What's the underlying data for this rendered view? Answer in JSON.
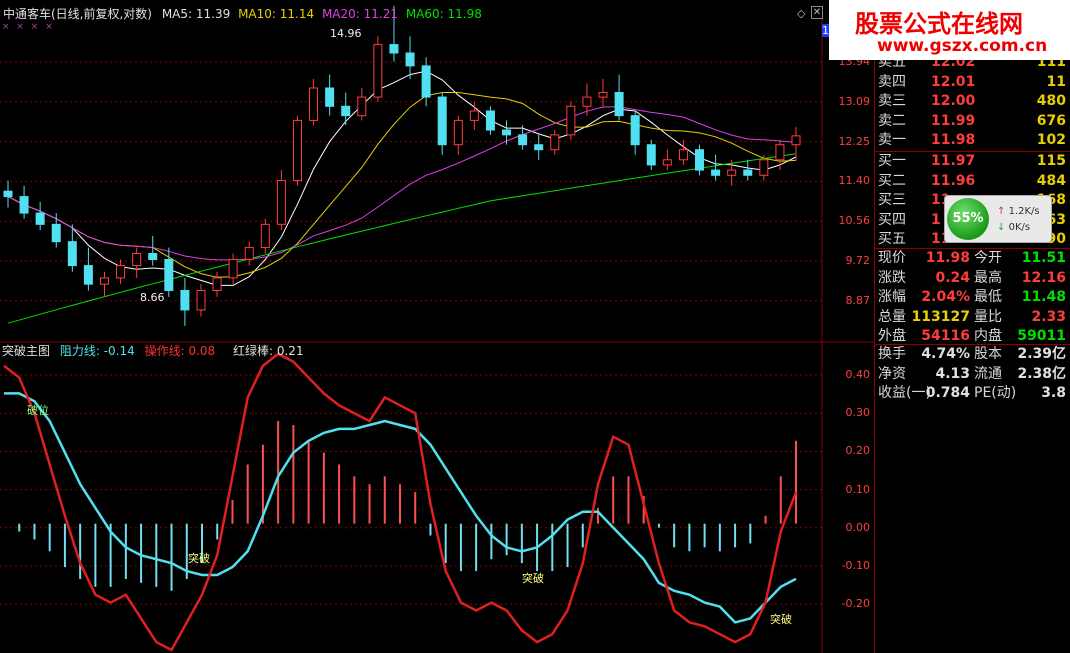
{
  "header": {
    "stock_title": "中通客车(日线,前复权,对数)",
    "ma5": "MA5: 11.39",
    "ma10": "MA10: 11.14",
    "ma20": "MA20: 11.21",
    "ma60": "MA60: 11.98",
    "max_label": "14.96",
    "min_label": "8.66",
    "price_tag": "14.0"
  },
  "price_axis": [
    "13.94",
    "13.09",
    "12.25",
    "11.40",
    "10.56",
    "9.72",
    "8.87"
  ],
  "indicator": {
    "name": "突破主图",
    "resist_label": "阻力线: -0.14",
    "op_label": "操作线: 0.08",
    "redgreen_label": "红绿棒: 0.21",
    "axis": [
      "0.40",
      "0.30",
      "0.20",
      "0.10",
      "0.00",
      "-0.10",
      "-0.20"
    ],
    "annotations": [
      "破位",
      "突破",
      "突破",
      "突破"
    ]
  },
  "order_book": {
    "asks": [
      {
        "label": "卖五",
        "price": "12.02",
        "vol": "111"
      },
      {
        "label": "卖四",
        "price": "12.01",
        "vol": "11"
      },
      {
        "label": "卖三",
        "price": "12.00",
        "vol": "480"
      },
      {
        "label": "卖二",
        "price": "11.99",
        "vol": "676"
      },
      {
        "label": "卖一",
        "price": "11.98",
        "vol": "102"
      }
    ],
    "bids": [
      {
        "label": "买一",
        "price": "11.97",
        "vol": "115"
      },
      {
        "label": "买二",
        "price": "11.96",
        "vol": "484"
      },
      {
        "label": "买三",
        "price": "11.",
        "vol": "168"
      },
      {
        "label": "买四",
        "price": "1",
        "vol": "163"
      },
      {
        "label": "买五",
        "price": "11.",
        "vol": "190"
      }
    ]
  },
  "stats": [
    {
      "l1": "现价",
      "v1": "11.98",
      "l2": "今开",
      "v2": "11.51"
    },
    {
      "l1": "涨跌",
      "v1": "0.24",
      "l2": "最高",
      "v2": "12.16"
    },
    {
      "l1": "涨幅",
      "v1": "2.04%",
      "l2": "最低",
      "v2": "11.48"
    },
    {
      "l1": "总量",
      "v1": "113127",
      "l2": "量比",
      "v2": "2.33"
    },
    {
      "l1": "外盘",
      "v1": "54116",
      "l2": "内盘",
      "v2": "59011"
    },
    {
      "l1": "换手",
      "v1": "4.74%",
      "l2": "股本",
      "v2": "2.39亿"
    },
    {
      "l1": "净资",
      "v1": "4.13",
      "l2": "流通",
      "v2": "2.38亿"
    },
    {
      "l1": "收益(一)",
      "v1": "0.784",
      "l2": "PE(动)",
      "v2": "3.8"
    }
  ],
  "network": {
    "percent": "55%",
    "up": "1.2K/s",
    "down": "0K/s",
    "up_icon": "arrow-up-icon",
    "down_icon": "arrow-down-icon"
  },
  "watermark": {
    "title": "股票公式在线网",
    "url": "www.gszx.com.cn"
  },
  "colors": {
    "up": "#ff3c3c",
    "down": "#50e0f0",
    "ma5": "#ffffff",
    "ma10": "#e8d000",
    "ma20": "#e040e0",
    "ma60": "#00e000",
    "grid": "#8b0000"
  },
  "chart_data": [
    {
      "type": "candlestick",
      "title": "中通客车(日线,前复权,对数)",
      "series_names": [
        "MA5",
        "MA10",
        "MA20",
        "MA60"
      ],
      "ylim": [
        8.6,
        14.6
      ],
      "candles": [
        [
          10.9,
          11.1,
          10.6,
          10.8
        ],
        [
          10.8,
          11.0,
          10.4,
          10.5
        ],
        [
          10.5,
          10.7,
          10.2,
          10.3
        ],
        [
          10.3,
          10.5,
          9.9,
          10.0
        ],
        [
          10.0,
          10.3,
          9.5,
          9.6
        ],
        [
          9.6,
          9.9,
          9.2,
          9.3
        ],
        [
          9.3,
          9.5,
          9.1,
          9.4
        ],
        [
          9.4,
          9.7,
          9.3,
          9.6
        ],
        [
          9.6,
          9.9,
          9.4,
          9.8
        ],
        [
          9.8,
          10.1,
          9.6,
          9.7
        ],
        [
          9.7,
          9.9,
          9.1,
          9.2
        ],
        [
          9.2,
          9.4,
          8.66,
          8.9
        ],
        [
          8.9,
          9.3,
          8.8,
          9.2
        ],
        [
          9.2,
          9.5,
          9.1,
          9.4
        ],
        [
          9.4,
          9.8,
          9.3,
          9.7
        ],
        [
          9.7,
          10.0,
          9.6,
          9.9
        ],
        [
          9.9,
          10.4,
          9.8,
          10.3
        ],
        [
          10.3,
          11.3,
          10.2,
          11.1
        ],
        [
          11.1,
          12.4,
          11.0,
          12.3
        ],
        [
          12.3,
          13.2,
          12.2,
          13.0
        ],
        [
          13.0,
          13.3,
          12.4,
          12.6
        ],
        [
          12.6,
          12.9,
          12.2,
          12.4
        ],
        [
          12.4,
          13.0,
          12.3,
          12.8
        ],
        [
          12.8,
          14.2,
          12.7,
          14.0
        ],
        [
          14.0,
          14.96,
          13.6,
          13.8
        ],
        [
          13.8,
          14.2,
          13.2,
          13.5
        ],
        [
          13.5,
          13.7,
          12.6,
          12.8
        ],
        [
          12.8,
          12.9,
          11.6,
          11.8
        ],
        [
          11.8,
          12.4,
          11.6,
          12.3
        ],
        [
          12.3,
          12.7,
          12.1,
          12.5
        ],
        [
          12.5,
          12.6,
          12.0,
          12.1
        ],
        [
          12.1,
          12.3,
          11.8,
          12.0
        ],
        [
          12.0,
          12.2,
          11.7,
          11.8
        ],
        [
          11.8,
          12.0,
          11.5,
          11.7
        ],
        [
          11.7,
          12.1,
          11.6,
          12.0
        ],
        [
          12.0,
          12.7,
          11.9,
          12.6
        ],
        [
          12.6,
          13.1,
          12.4,
          12.8
        ],
        [
          12.8,
          13.2,
          12.6,
          12.9
        ],
        [
          12.9,
          13.3,
          12.3,
          12.4
        ],
        [
          12.4,
          12.5,
          11.6,
          11.8
        ],
        [
          11.8,
          11.9,
          11.3,
          11.4
        ],
        [
          11.4,
          11.7,
          11.3,
          11.5
        ],
        [
          11.5,
          11.9,
          11.4,
          11.7
        ],
        [
          11.7,
          11.8,
          11.2,
          11.3
        ],
        [
          11.3,
          11.6,
          11.1,
          11.2
        ],
        [
          11.2,
          11.5,
          11.0,
          11.3
        ],
        [
          11.3,
          11.5,
          11.1,
          11.2
        ],
        [
          11.2,
          11.6,
          11.1,
          11.5
        ],
        [
          11.5,
          11.9,
          11.3,
          11.8
        ],
        [
          11.8,
          12.16,
          11.48,
          11.98
        ]
      ]
    },
    {
      "type": "line",
      "title": "突破主图",
      "series_names": [
        "阻力线",
        "操作线",
        "红绿棒"
      ],
      "ylim": [
        -0.32,
        0.44
      ],
      "resist": [
        0.33,
        0.33,
        0.31,
        0.26,
        0.18,
        0.1,
        0.04,
        -0.02,
        -0.06,
        -0.08,
        -0.09,
        -0.1,
        -0.12,
        -0.13,
        -0.13,
        -0.11,
        -0.07,
        0.02,
        0.12,
        0.18,
        0.21,
        0.23,
        0.24,
        0.24,
        0.25,
        0.26,
        0.25,
        0.24,
        0.2,
        0.14,
        0.08,
        0.02,
        -0.03,
        -0.06,
        -0.07,
        -0.06,
        -0.03,
        0.01,
        0.03,
        0.03,
        -0.01,
        -0.05,
        -0.09,
        -0.15,
        -0.17,
        -0.18,
        -0.2,
        -0.21,
        -0.25,
        -0.24,
        -0.2,
        -0.16,
        -0.14
      ],
      "operate": [
        0.4,
        0.37,
        0.28,
        0.15,
        0.02,
        -0.1,
        -0.18,
        -0.2,
        -0.18,
        -0.24,
        -0.3,
        -0.32,
        -0.25,
        -0.18,
        -0.08,
        0.12,
        0.32,
        0.4,
        0.43,
        0.41,
        0.37,
        0.33,
        0.3,
        0.28,
        0.26,
        0.32,
        0.3,
        0.28,
        0.05,
        -0.12,
        -0.2,
        -0.22,
        -0.2,
        -0.22,
        -0.27,
        -0.3,
        -0.28,
        -0.22,
        -0.1,
        0.1,
        0.22,
        0.2,
        0.05,
        -0.1,
        -0.22,
        -0.25,
        -0.26,
        -0.28,
        -0.3,
        -0.28,
        -0.2,
        -0.02,
        0.08
      ],
      "redgreen": [
        0,
        -0.02,
        -0.04,
        -0.07,
        -0.11,
        -0.14,
        -0.16,
        -0.16,
        -0.14,
        -0.15,
        -0.16,
        -0.17,
        -0.14,
        -0.1,
        -0.04,
        0.06,
        0.15,
        0.2,
        0.26,
        0.25,
        0.21,
        0.18,
        0.15,
        0.12,
        0.1,
        0.12,
        0.1,
        0.08,
        -0.03,
        -0.1,
        -0.12,
        -0.12,
        -0.09,
        -0.08,
        -0.1,
        -0.12,
        -0.12,
        -0.11,
        -0.06,
        0.04,
        0.12,
        0.12,
        0.07,
        -0.01,
        -0.06,
        -0.07,
        -0.06,
        -0.07,
        -0.06,
        -0.05,
        0.02,
        0.12,
        0.21
      ]
    }
  ]
}
